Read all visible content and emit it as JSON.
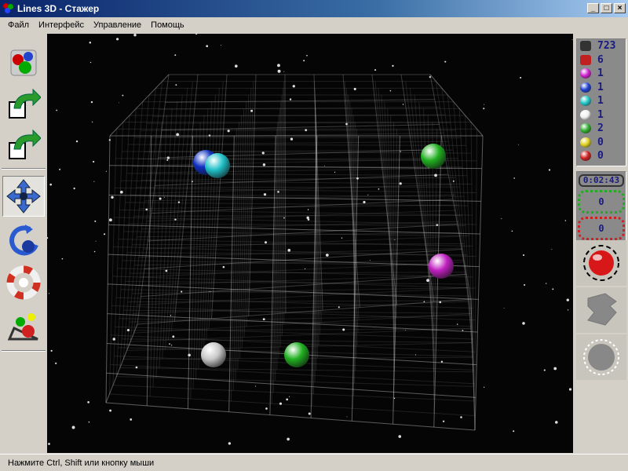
{
  "window": {
    "title": "Lines 3D - Стажер",
    "minimize": "_",
    "maximize": "□",
    "close": "×"
  },
  "menu": [
    "Файл",
    "Интерфейс",
    "Управление",
    "Помощь"
  ],
  "left_toolbar": [
    {
      "name": "new-game-button",
      "icon": "cube-balls-icon"
    },
    {
      "name": "undo-button",
      "icon": "arrow-back-icon"
    },
    {
      "name": "redo-button",
      "icon": "arrow-forward-icon"
    },
    {
      "name": "move-mode-button",
      "icon": "four-way-arrow-icon",
      "active": true
    },
    {
      "name": "rotate-mode-button",
      "icon": "rotate-icon"
    },
    {
      "name": "help-button",
      "icon": "lifebuoy-icon"
    },
    {
      "name": "settings-button",
      "icon": "balls-ramp-icon"
    }
  ],
  "stats": {
    "total_cells": "723",
    "occupied": "6",
    "balls": [
      {
        "color": "#d020d0",
        "count": "1"
      },
      {
        "color": "#2040d0",
        "count": "1"
      },
      {
        "color": "#20c8c8",
        "count": "1"
      },
      {
        "color": "#f0f0f0",
        "count": "1"
      },
      {
        "color": "#30b030",
        "count": "2"
      },
      {
        "color": "#e0d020",
        "count": "0"
      },
      {
        "color": "#d02020",
        "count": "0"
      }
    ]
  },
  "timer": "0:02:43",
  "score_green": "0",
  "score_red": "0",
  "scene_balls": [
    {
      "color": "#1030c0",
      "ix": 2,
      "iy": 1
    },
    {
      "color": "#20c0c8",
      "ix": 2.3,
      "iy": 1.1
    },
    {
      "color": "#20b020",
      "ix": 7.5,
      "iy": 0.8
    },
    {
      "color": "#c020c0",
      "ix": 7.7,
      "iy": 4.5
    },
    {
      "color": "#c8c8c8",
      "ix": 2.2,
      "iy": 7.5
    },
    {
      "color": "#20b020",
      "ix": 4.2,
      "iy": 7.5
    }
  ],
  "status": "Нажмите Ctrl, Shift или кнопку мыши"
}
